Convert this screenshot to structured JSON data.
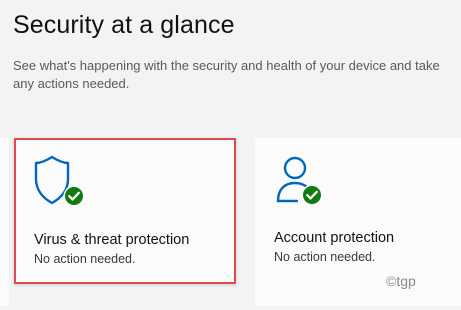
{
  "page": {
    "title": "Security at a glance",
    "subtitle": "See what's happening with the security and health of your device and take any actions needed."
  },
  "tiles": [
    {
      "title": "Virus & threat protection",
      "status": "No action needed.",
      "icon": "shield-icon",
      "status_icon": "check-badge-icon"
    },
    {
      "title": "Account protection",
      "status": "No action needed.",
      "icon": "person-icon",
      "status_icon": "check-badge-icon"
    }
  ],
  "watermark": "©tgp",
  "colors": {
    "accent": "#0067c0",
    "success": "#107c10",
    "highlight": "#e04a4f",
    "background": "#f3f3f3",
    "tile": "#fbfbfb"
  }
}
